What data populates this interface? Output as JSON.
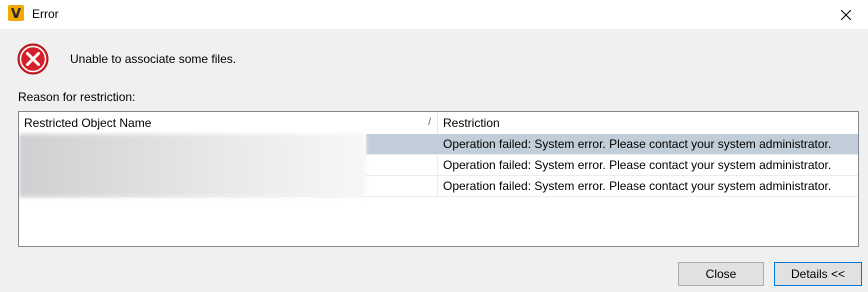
{
  "window": {
    "title": "Error",
    "app_icon": "app-logo-icon",
    "close_icon": "close-icon"
  },
  "message": {
    "icon": "error-icon",
    "text": "Unable to associate some files."
  },
  "reason_label": "Reason for restriction:",
  "table": {
    "columns": [
      "Restricted Object Name",
      "Restriction"
    ],
    "rows": [
      {
        "object_name": "",
        "restriction": "Operation failed:  System error.  Please contact your system administrator.",
        "selected": true
      },
      {
        "object_name": "",
        "restriction": "Operation failed:  System error.  Please contact your system administrator.",
        "selected": false
      },
      {
        "object_name": "",
        "restriction": "Operation failed:  System error.  Please contact your system administrator.",
        "selected": false
      }
    ]
  },
  "buttons": {
    "close_label": "Close",
    "details_label": "Details <<"
  },
  "colors": {
    "selection": "#c1cdd9",
    "error_red": "#d4202a",
    "focus_border": "#0078d7"
  }
}
